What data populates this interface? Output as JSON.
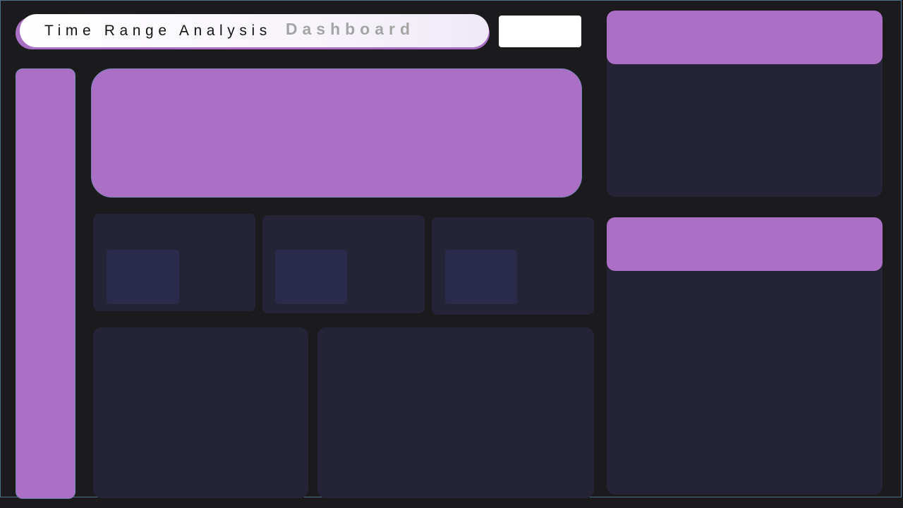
{
  "header": {
    "title_main": "Time Range Analysis",
    "title_accent": "Dashboard"
  },
  "colors": {
    "background": "#1b1a1c",
    "accent": "#ab6fc5",
    "card": "#242436",
    "kpi_inner": "#2a2b4b",
    "title_text": "#141414",
    "title_accent_text": "#a5a5a5"
  },
  "kpi_cards": [
    {
      "label": ""
    },
    {
      "label": ""
    },
    {
      "label": ""
    }
  ]
}
